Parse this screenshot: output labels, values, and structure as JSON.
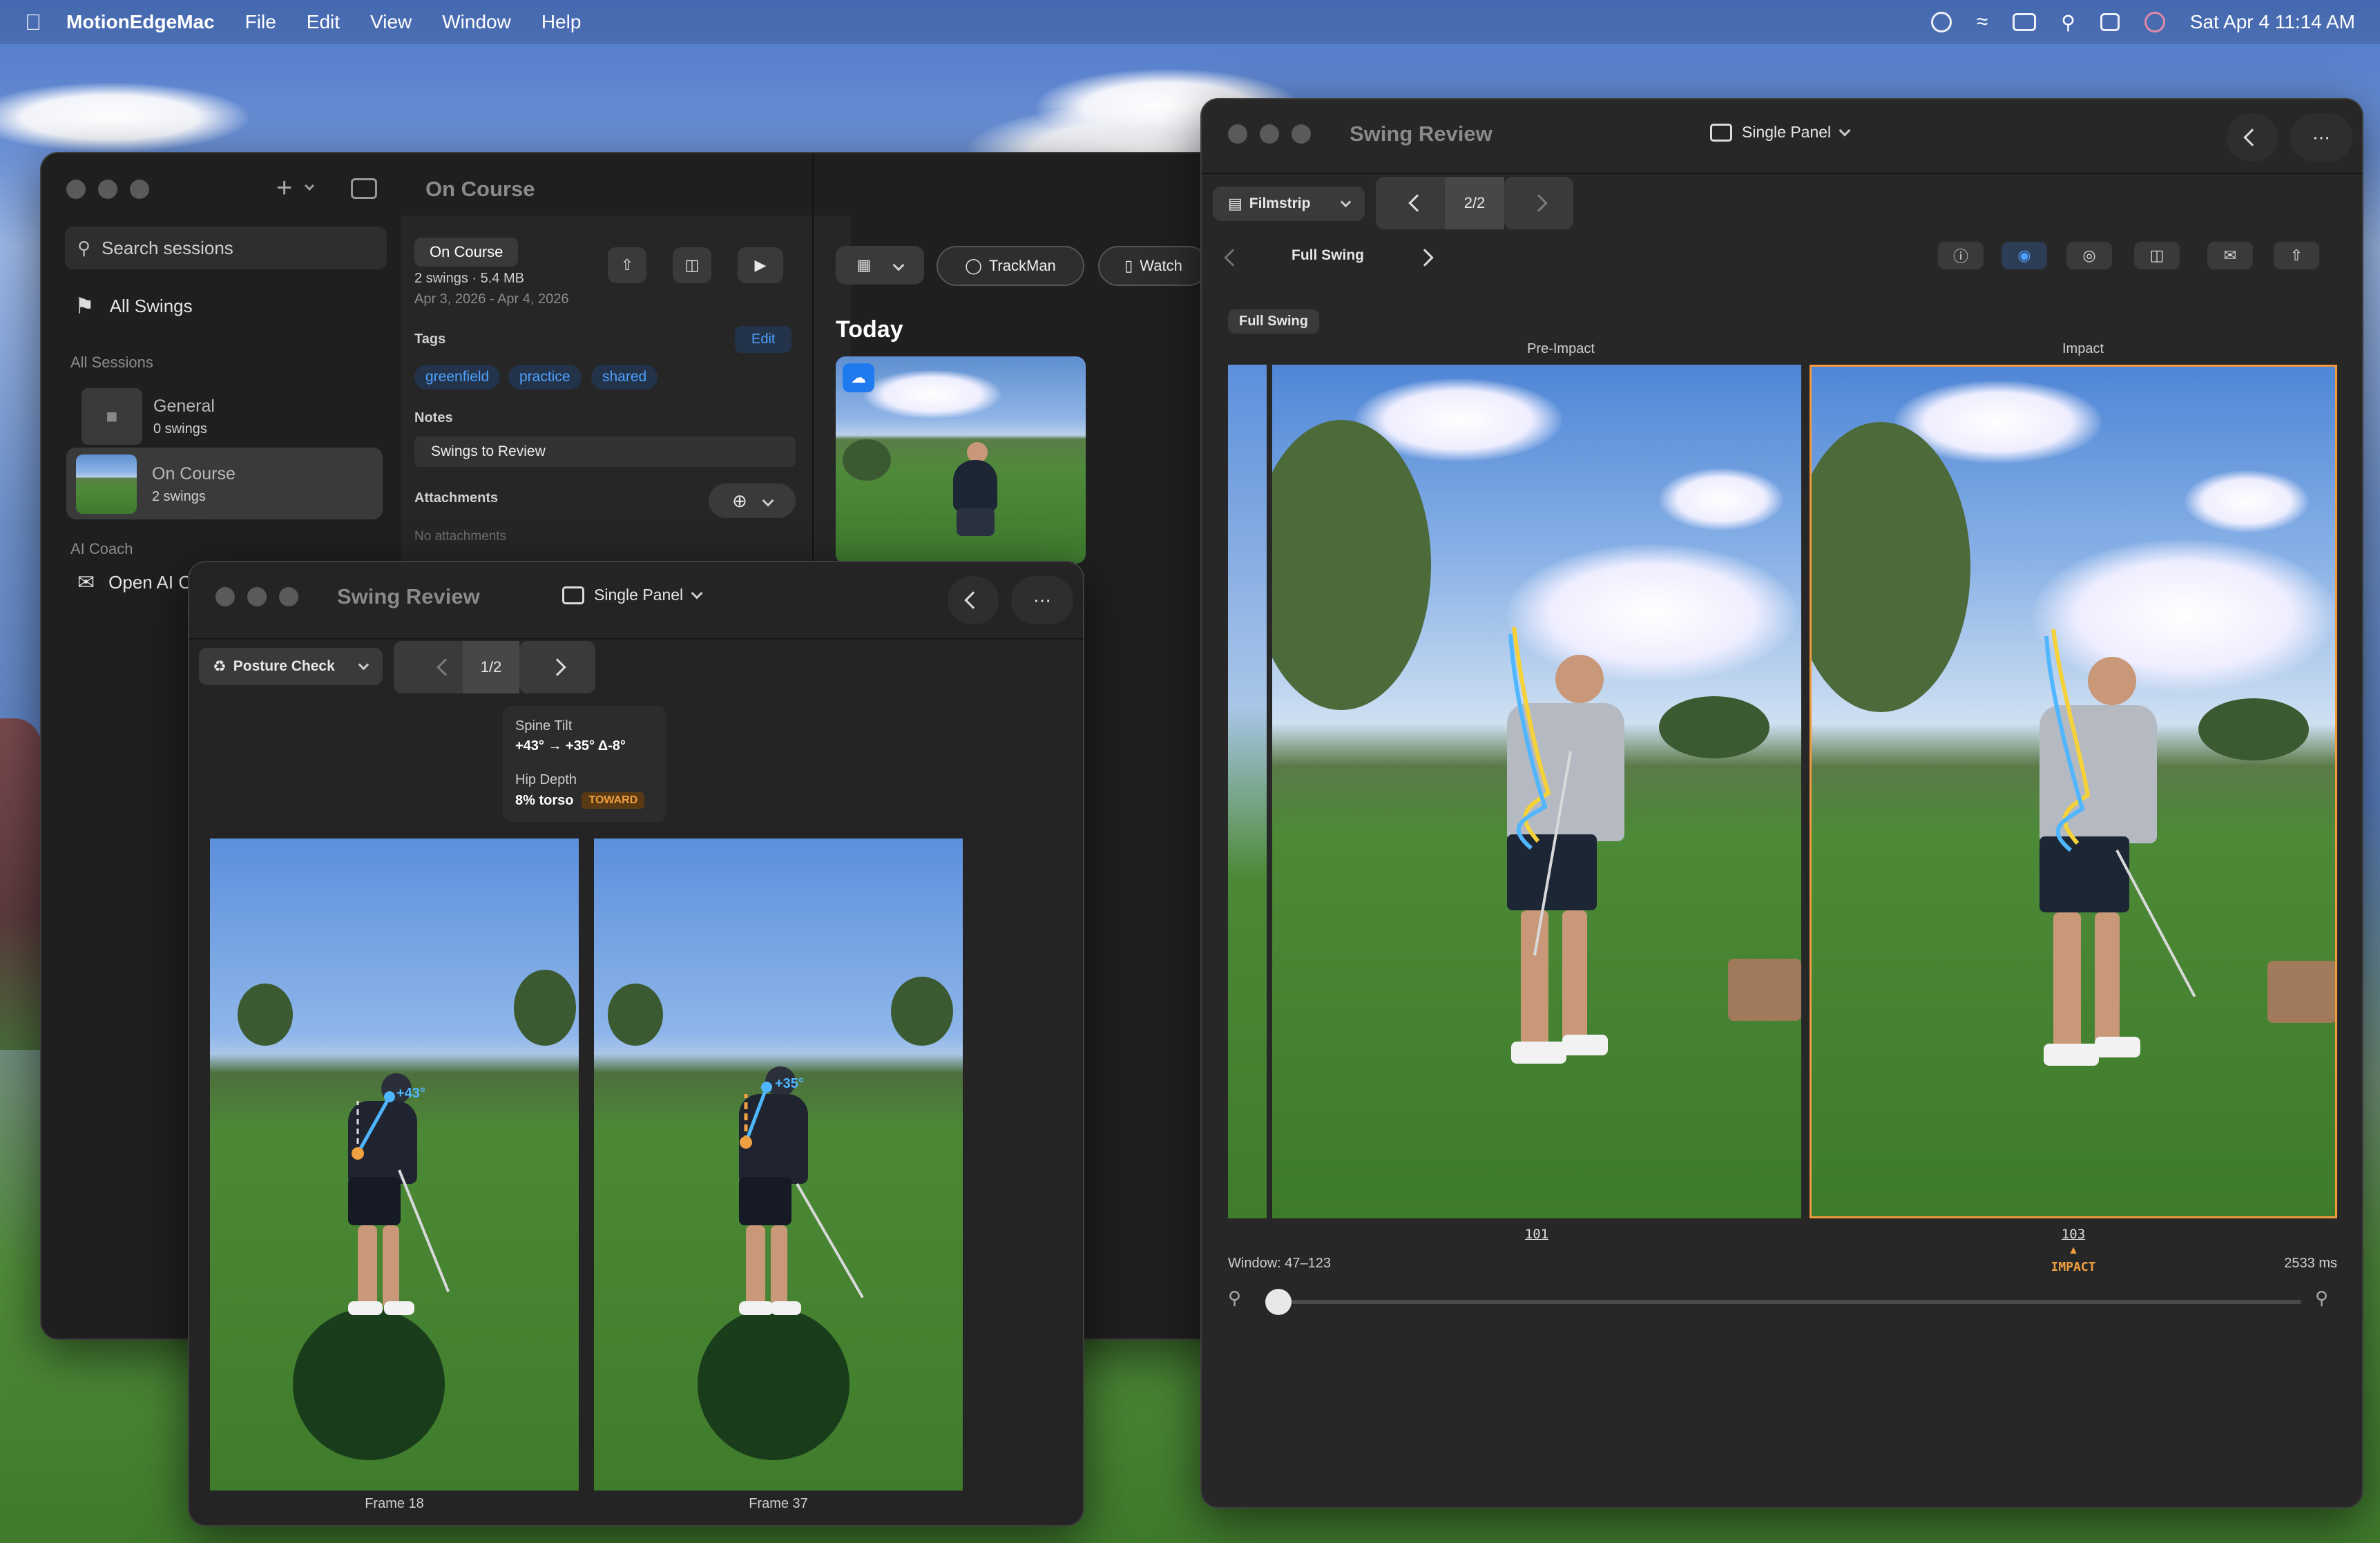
{
  "menubar": {
    "app_name": "MotionEdgeMac",
    "menus": [
      "File",
      "Edit",
      "View",
      "Window",
      "Help"
    ],
    "clock": "Sat Apr 4  11:14 AM"
  },
  "main_window": {
    "title": "On Course",
    "search_placeholder": "Search sessions",
    "all_swings": "All Swings",
    "all_sessions_header": "All Sessions",
    "sessions": [
      {
        "name": "General",
        "count": "0 swings"
      },
      {
        "name": "On Course",
        "count": "2 swings"
      }
    ],
    "ai_coach_header": "AI Coach",
    "open_ai": "Open AI C",
    "detail": {
      "badge": "On Course",
      "meta": "2 swings · 5.4 MB",
      "dates": "Apr 3, 2026 - Apr 4, 2026",
      "tags_label": "Tags",
      "edit_label": "Edit",
      "tags": [
        "greenfield",
        "practice",
        "shared"
      ],
      "notes_label": "Notes",
      "notes_value": "Swings to Review",
      "attachments_label": "Attachments",
      "no_attachments": "No attachments"
    },
    "toolbar": {
      "trackman": "TrackMan",
      "watch": "Watch"
    },
    "today": "Today"
  },
  "review_small": {
    "title": "Swing Review",
    "layout_select": "Single Panel",
    "mode": "Posture Check",
    "page": "1/2",
    "metrics": {
      "spine_label": "Spine Tilt",
      "spine_value": "+43° → +35° Δ-8°",
      "hip_label": "Hip Depth",
      "hip_value": "8% torso",
      "hip_badge": "TOWARD"
    },
    "overlay_left": "+43°",
    "overlay_right": "+35°",
    "frames": [
      "Frame 18",
      "Frame 37"
    ]
  },
  "review_large": {
    "title": "Swing Review",
    "layout_select": "Single Panel",
    "view_mode": "Filmstrip",
    "page": "2/2",
    "category": "Full Swing",
    "section_badge": "Full Swing",
    "col_left": "Pre-Impact",
    "col_right": "Impact",
    "frame_left": "101",
    "frame_right": "103",
    "impact_label": "IMPACT",
    "window_range": "Window: 47–123",
    "duration": "2533 ms",
    "zoom_position": 0.0,
    "colors": {
      "accent": "#f0a040",
      "selection": "#f29a3c",
      "overlay_blue": "#4fb6ff",
      "overlay_yellow": "#f5d23a"
    }
  }
}
